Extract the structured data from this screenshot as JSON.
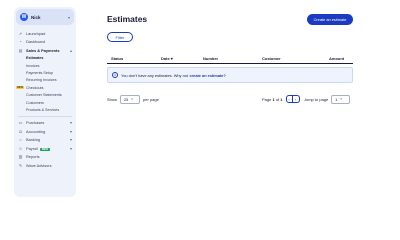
{
  "sidebar": {
    "profile_name": "Nick",
    "items": [
      {
        "label": "Launchpad",
        "icon": "rocket-icon"
      },
      {
        "label": "Dashboard",
        "icon": "dashboard-icon"
      },
      {
        "label": "Sales & Payments",
        "icon": "sales-icon"
      }
    ],
    "sales_sub": [
      {
        "label": "Estimates",
        "active": true
      },
      {
        "label": "Invoices"
      },
      {
        "label": "Payments Setup"
      },
      {
        "label": "Recurring Invoices"
      },
      {
        "label": "Checkouts",
        "tag": "NEW"
      },
      {
        "label": "Customer Statements"
      },
      {
        "label": "Customers"
      },
      {
        "label": "Products & Services"
      }
    ],
    "more_items": [
      {
        "label": "Purchases",
        "icon": "purchases-icon"
      },
      {
        "label": "Accounting",
        "icon": "accounting-icon"
      },
      {
        "label": "Banking",
        "icon": "bank-icon"
      },
      {
        "label": "Payroll",
        "icon": "payroll-icon",
        "badge": "NEW"
      },
      {
        "label": "Reports",
        "icon": "reports-icon"
      },
      {
        "label": "Wave Advisors",
        "icon": "advisors-icon"
      }
    ]
  },
  "main": {
    "title": "Estimates",
    "create_label": "Create an estimate",
    "filter_label": "Filter",
    "columns": [
      "Status",
      "Date",
      "Number",
      "Customer",
      "Amount"
    ],
    "sort_indicator": "▾",
    "empty_text": "You don't have any estimates. Why not",
    "empty_link": "create an estimate?"
  },
  "pagination": {
    "show_label": "Show",
    "per_page_value": "25",
    "per_page_label": "per page",
    "page_label": "Page",
    "page_current": "1",
    "page_of": "of",
    "page_total": "1",
    "jump_label": "Jump to page",
    "jump_value": "1"
  }
}
